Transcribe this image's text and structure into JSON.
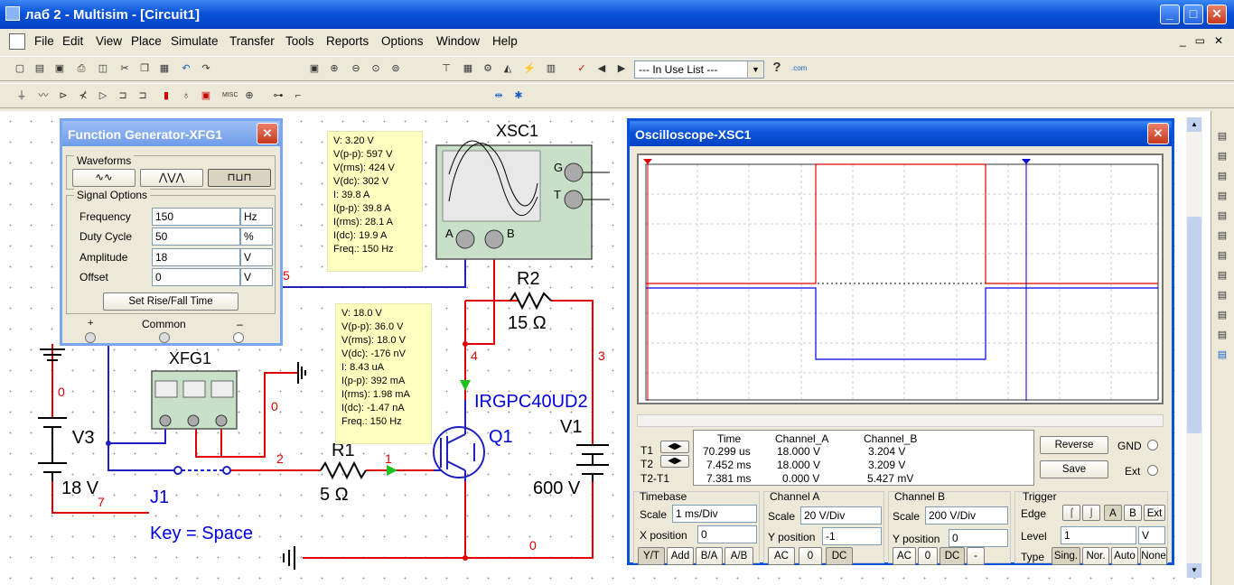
{
  "app": {
    "title": "лаб 2 - Multisim - [Circuit1]",
    "buttons": [
      "_",
      "□",
      "✕"
    ]
  },
  "menu": [
    "File",
    "Edit",
    "View",
    "Place",
    "Simulate",
    "Transfer",
    "Tools",
    "Reports",
    "Options",
    "Window",
    "Help"
  ],
  "toolbar": {
    "in_use_list": "--- In Use List ---",
    "help": "?"
  },
  "fg": {
    "title": "Function Generator-XFG1",
    "waveforms_label": "Waveforms",
    "signal_options_label": "Signal Options",
    "rows": [
      {
        "label": "Frequency",
        "value": "150",
        "unit": "Hz"
      },
      {
        "label": "Duty Cycle",
        "value": "50",
        "unit": "%"
      },
      {
        "label": "Amplitude",
        "value": "18",
        "unit": "V"
      },
      {
        "label": "Offset",
        "value": "0",
        "unit": "V"
      }
    ],
    "set_rise": "Set Rise/Fall Time",
    "plus": "+",
    "common": "Common",
    "minus": "–"
  },
  "probe1": [
    "V: 3.20 V",
    "V(p-p): 597 V",
    "V(rms): 424 V",
    "V(dc): 302 V",
    "I: 39.8 A",
    "I(p-p): 39.8 A",
    "I(rms): 28.1 A",
    "I(dc): 19.9 A",
    "Freq.: 150 Hz"
  ],
  "probe2": [
    "V: 18.0 V",
    "V(p-p): 36.0 V",
    "V(rms): 18.0 V",
    "V(dc): -176 nV",
    "I: 8.43 uA",
    "I(p-p): 392 mA",
    "I(rms): 1.98 mA",
    "I(dc): -1.47 nA",
    "Freq.: 150 Hz"
  ],
  "circuit": {
    "xsc1": "XSC1",
    "xfg1": "XFG1",
    "g": "G",
    "t": "T",
    "a": "A",
    "b": "B",
    "r2": "R2",
    "r2v": "15 Ω",
    "r1": "R1",
    "r1v": "5 Ω",
    "v1": "V1",
    "v1v": "600 V",
    "v3": "V3",
    "v3v": "18 V",
    "q1": "Q1",
    "q1m": "IRGPC40UD2",
    "j1": "J1",
    "key": "Key = Space",
    "nodes": {
      "n5": "5",
      "n4": "4",
      "n3": "3",
      "n0a": "0",
      "n0b": "0",
      "n0c": "0",
      "n2": "2",
      "n1": "1",
      "n7": "7"
    }
  },
  "osc": {
    "title": "Oscilloscope-XSC1",
    "readout": {
      "headers": [
        "Time",
        "Channel_A",
        "Channel_B"
      ],
      "rows": [
        {
          "label": "T1",
          "time": "70.299 us",
          "a": "18.000 V",
          "b": "3.204 V"
        },
        {
          "label": "T2",
          "time": "7.452 ms",
          "a": "18.000 V",
          "b": "3.209 V"
        },
        {
          "label": "T2-T1",
          "time": "7.381 ms",
          "a": "0.000 V",
          "b": "5.427 mV"
        }
      ]
    },
    "reverse": "Reverse",
    "save": "Save",
    "gnd": "GND",
    "ext": "Ext",
    "timebase": {
      "label": "Timebase",
      "scale_label": "Scale",
      "scale": "1 ms/Div",
      "xpos_label": "X position",
      "xpos": "0",
      "buttons": [
        "Y/T",
        "Add",
        "B/A",
        "A/B"
      ]
    },
    "cha": {
      "label": "Channel A",
      "scale_label": "Scale",
      "scale": "20  V/Div",
      "ypos_label": "Y position",
      "ypos": "-1",
      "buttons": [
        "AC",
        "0",
        "DC"
      ]
    },
    "chb": {
      "label": "Channel B",
      "scale_label": "Scale",
      "scale": "200  V/Div",
      "ypos_label": "Y position",
      "ypos": "0",
      "buttons": [
        "AC",
        "0",
        "DC",
        "-"
      ]
    },
    "trigger": {
      "label": "Trigger",
      "edge_label": "Edge",
      "level_label": "Level",
      "level": "1",
      "level_unit": "V",
      "type_label": "Type",
      "buttons": [
        "A",
        "B",
        "Ext"
      ],
      "types": [
        "Sing.",
        "Nor.",
        "Auto",
        "None"
      ]
    }
  },
  "colors": {
    "wire_red": "#e00000",
    "wire_blue": "#2020c0",
    "trace_a": "#e00000",
    "trace_b": "#0000e0",
    "probe": "#ffffc0"
  }
}
